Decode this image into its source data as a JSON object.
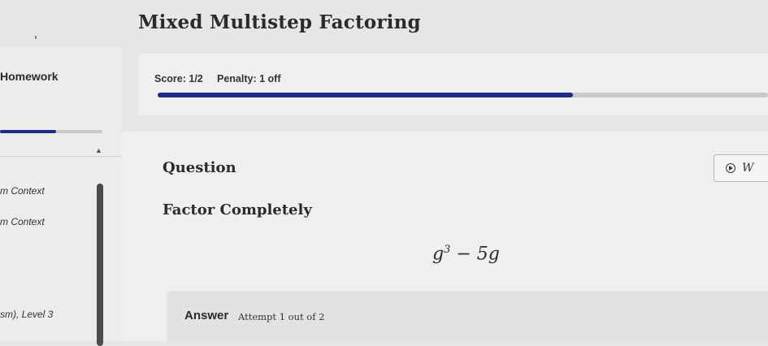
{
  "header": {
    "title": "Mixed Multistep Factoring"
  },
  "sidebar": {
    "heading": "Homework",
    "progress": 0.55,
    "items": [
      {
        "label": "m Context"
      },
      {
        "label": "m Context"
      },
      {
        "label": "sm), Level 3"
      }
    ]
  },
  "score": {
    "score_text": "Score: 1/2",
    "penalty_text": "Penalty: 1 off",
    "progress_fraction": 0.68
  },
  "question": {
    "label": "Question",
    "watch_button_label": "W",
    "instruction": "Factor Completely",
    "expression": {
      "base": "g",
      "exponent": "3",
      "rest": " − 5g"
    }
  },
  "answer": {
    "label": "Answer",
    "attempt_text": "Attempt 1 out of 2"
  },
  "colors": {
    "accent": "#1d2b8a",
    "background": "#e6e6e4",
    "panel": "#efefed"
  }
}
